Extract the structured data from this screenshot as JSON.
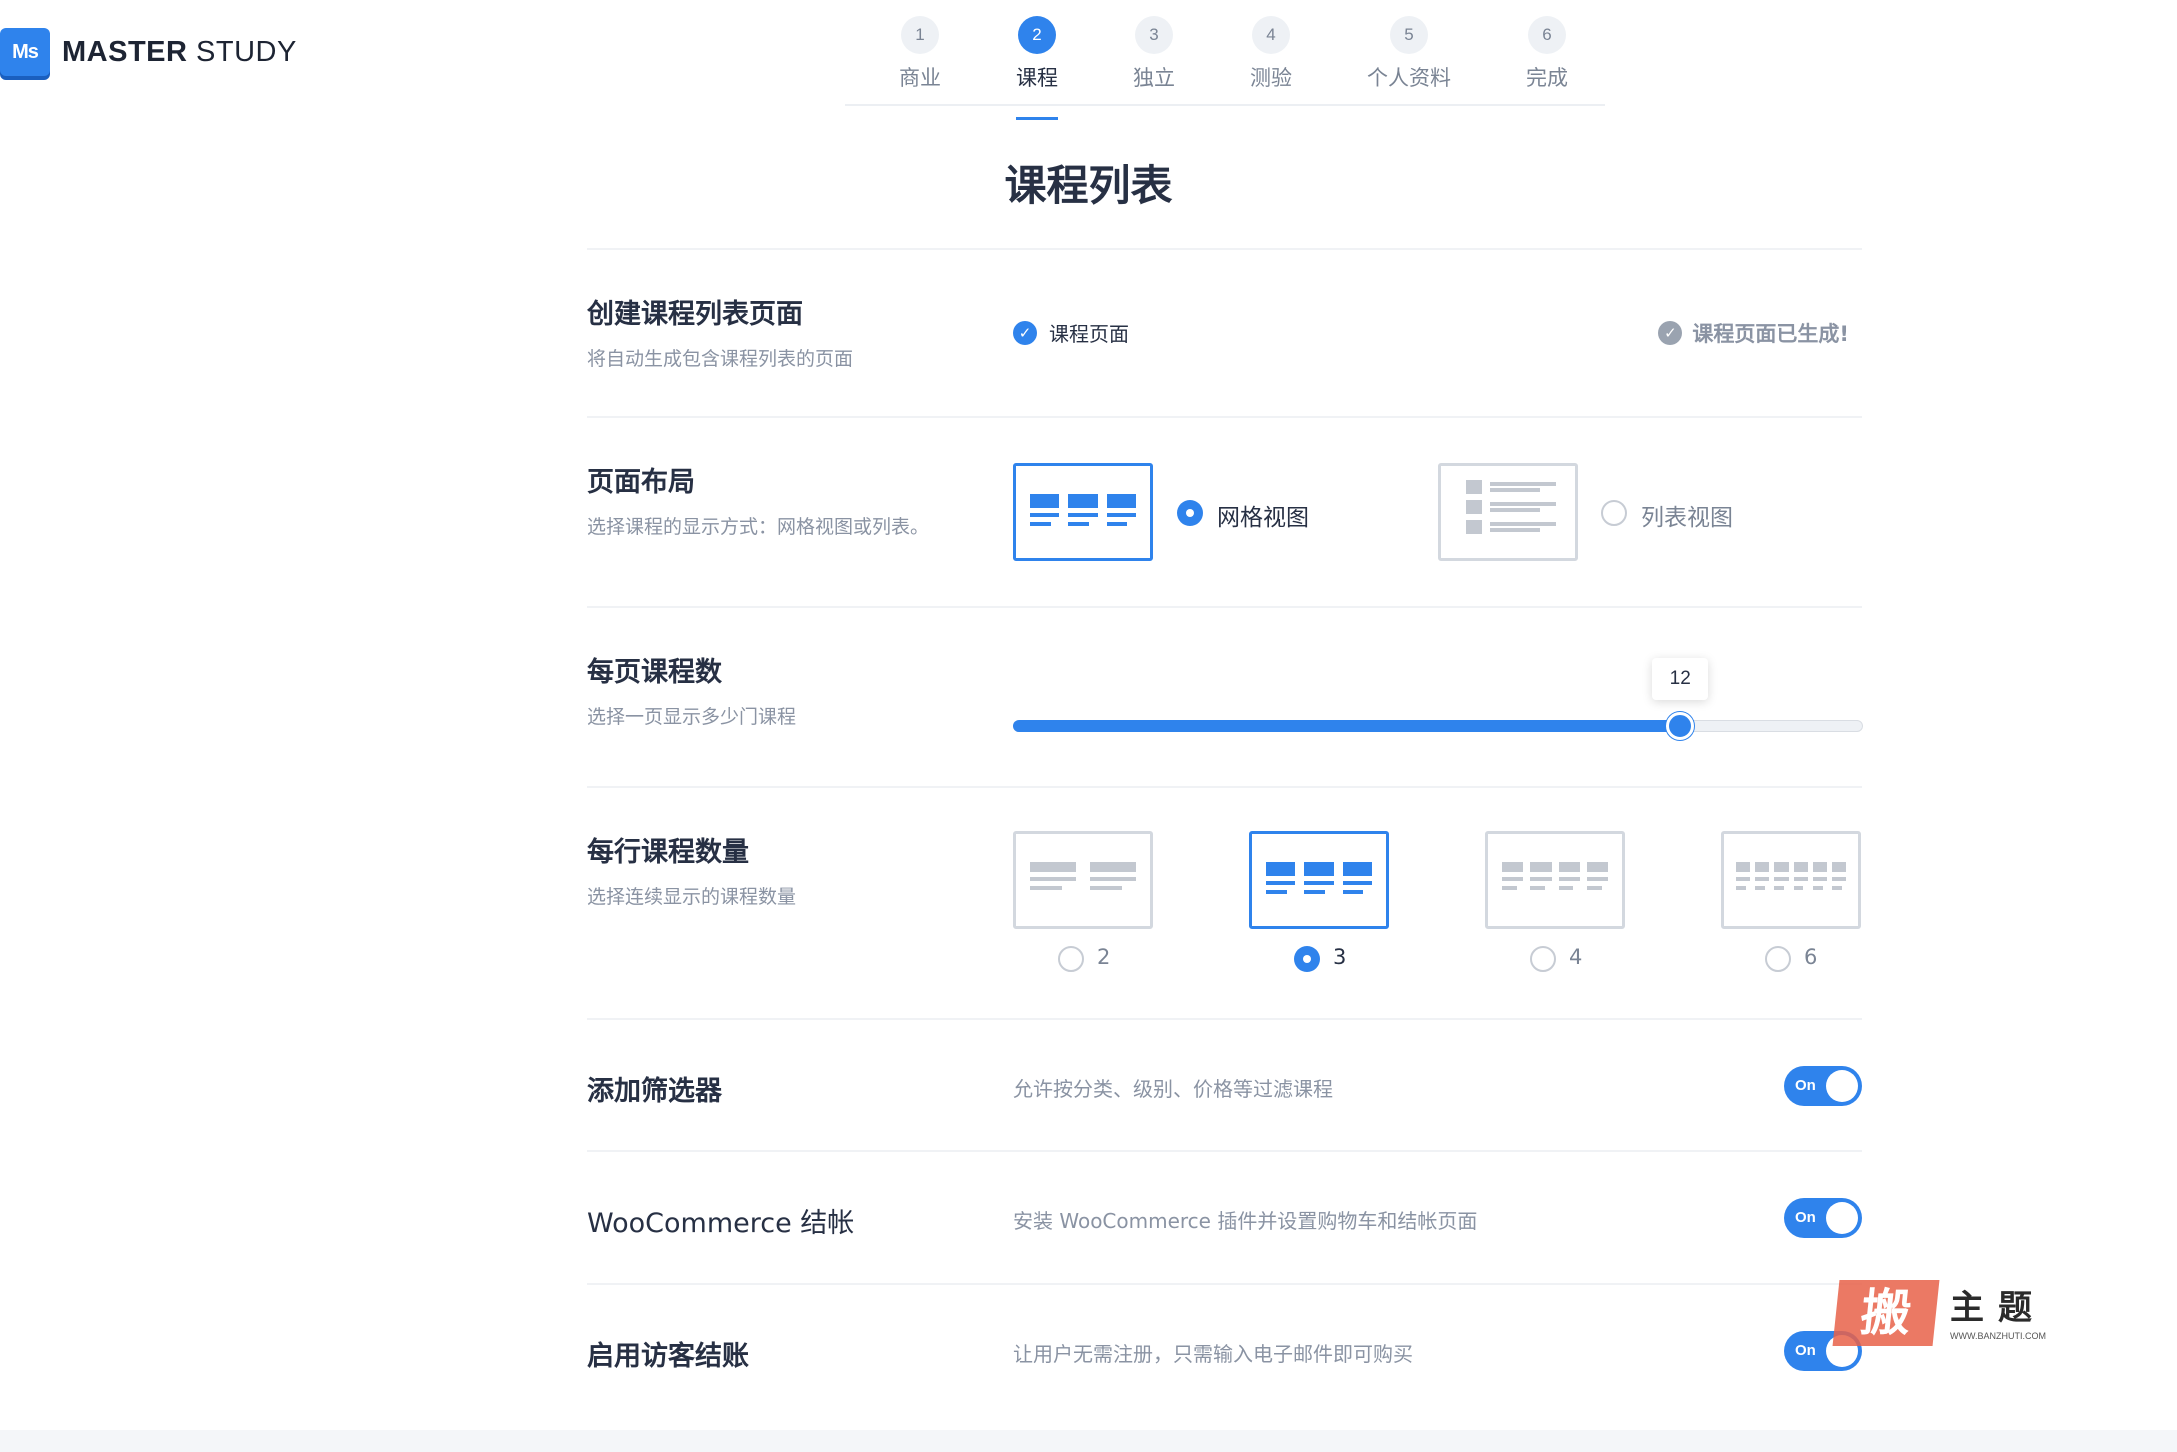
{
  "logo": {
    "badge": "Ms",
    "text_bold": "MASTER",
    "text_light": " STUDY"
  },
  "stepper": [
    {
      "num": "1",
      "label": "商业",
      "active": false
    },
    {
      "num": "2",
      "label": "课程",
      "active": true
    },
    {
      "num": "3",
      "label": "独立",
      "active": false
    },
    {
      "num": "4",
      "label": "测验",
      "active": false
    },
    {
      "num": "5",
      "label": "个人资料",
      "active": false
    },
    {
      "num": "6",
      "label": "完成",
      "active": false
    }
  ],
  "page_title": "课程列表",
  "create_page": {
    "title": "创建课程列表页面",
    "desc": "将自动生成包含课程列表的页面",
    "checkbox_label": "课程页面",
    "checked": true,
    "generated_label": "课程页面已生成!"
  },
  "page_layout": {
    "title": "页面布局",
    "desc": "选择课程的显示方式：网格视图或列表。",
    "options": [
      {
        "label": "网格视图",
        "selected": true
      },
      {
        "label": "列表视图",
        "selected": false
      }
    ]
  },
  "per_page": {
    "title": "每页课程数",
    "desc": "选择一页显示多少门课程",
    "value": "12",
    "fill_fraction": 0.785
  },
  "per_row": {
    "title": "每行课程数量",
    "desc": "选择连续显示的课程数量",
    "options": [
      {
        "label": "2",
        "selected": false
      },
      {
        "label": "3",
        "selected": true
      },
      {
        "label": "4",
        "selected": false
      },
      {
        "label": "6",
        "selected": false
      }
    ]
  },
  "toggles": [
    {
      "title": "添加筛选器",
      "desc": "允许按分类、级别、价格等过滤课程",
      "state": "On"
    },
    {
      "title": "WooCommerce 结帐",
      "desc": "安装 WooCommerce 插件并设置购物车和结帐页面",
      "state": "On"
    },
    {
      "title": "启用访客结账",
      "desc": "让用户无需注册，只需输入电子邮件即可购买",
      "state": "On"
    }
  ],
  "watermark": {
    "stamp": "搬",
    "chars": "主题",
    "url": "WWW.BANZHUTI.COM"
  },
  "colors": {
    "accent": "#2f83ec",
    "text": "#273044",
    "muted": "#8a93a3",
    "border": "#d3d8df"
  }
}
